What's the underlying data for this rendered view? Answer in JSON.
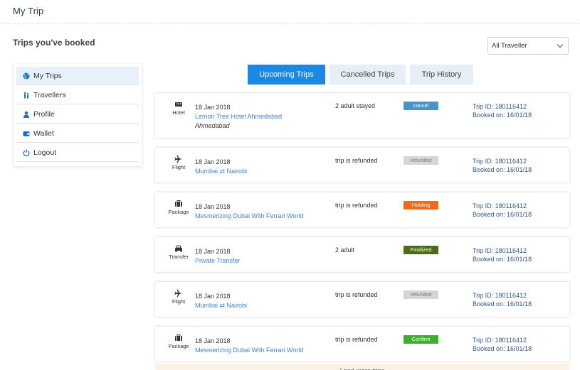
{
  "header": {
    "title": "My Trip"
  },
  "section": {
    "title": "Trips you've booked"
  },
  "filter": {
    "selected": "All Traveller"
  },
  "sidebar": {
    "items": [
      {
        "label": "My Trips",
        "icon": "globe-icon"
      },
      {
        "label": "Travellers",
        "icon": "travellers-icon"
      },
      {
        "label": "Profile",
        "icon": "user-icon"
      },
      {
        "label": "Wallet",
        "icon": "wallet-icon"
      },
      {
        "label": "Logout",
        "icon": "power-icon"
      }
    ]
  },
  "tabs": [
    {
      "label": "Upcoming Trips"
    },
    {
      "label": "Cancelled Trips"
    },
    {
      "label": "Trip History"
    }
  ],
  "trips": [
    {
      "type": "Hotel",
      "icon": "hotel-icon",
      "date": "18 Jan 2018",
      "name": "Lemon Tree Hotel Ahmedabad",
      "city": "Ahmedabad",
      "status": "2 adult stayed",
      "badge": "cancel",
      "badge_color": "#4a93c9",
      "trip_id": "Trip ID: 180116412",
      "booked_on": "Booked on: 16/01/18"
    },
    {
      "type": "Flight",
      "icon": "plane-icon",
      "date": "18 Jan 2018",
      "name": "Mumbai ⇄ Nairobi",
      "status": "trip is refunded",
      "badge": "refunded",
      "badge_color": "#d6d6d6",
      "trip_id": "Trip ID: 180116412",
      "booked_on": "Booked on: 16/01/18"
    },
    {
      "type": "Package",
      "icon": "package-icon",
      "date": "18 Jan 2018",
      "name": "Mesmerizing Dubai With Ferrari World",
      "status": "trip is refunded",
      "badge": "Holding",
      "badge_color": "#f06a1a",
      "trip_id": "Trip ID: 180116412",
      "booked_on": "Booked on: 16/01/18"
    },
    {
      "type": "Transfer",
      "icon": "car-icon",
      "date": "18 Jan 2018",
      "name": "Private Transfer",
      "status": "2 adult",
      "badge": "Finalized",
      "badge_color": "#4d6a16",
      "trip_id": "Trip ID: 180116412",
      "booked_on": "Booked on: 16/01/18"
    },
    {
      "type": "Flight",
      "icon": "plane-icon",
      "date": "18 Jan 2018",
      "name": "Mumbai ⇄ Nairobi",
      "status": "trip is refunded",
      "badge": "refunded",
      "badge_color": "#d6d6d6",
      "trip_id": "Trip ID: 180116412",
      "booked_on": "Booked on: 16/01/18"
    },
    {
      "type": "Package",
      "icon": "package-icon",
      "date": "18 Jan 2018",
      "name": "Mesmerizing Dubai With Ferrari World",
      "status": "trip is refunded",
      "badge": "Confirm",
      "badge_color": "#3fae2a",
      "trip_id": "Trip ID: 180116412",
      "booked_on": "Booked on: 16/01/18"
    }
  ],
  "load_more": {
    "label": "Load more trips"
  }
}
